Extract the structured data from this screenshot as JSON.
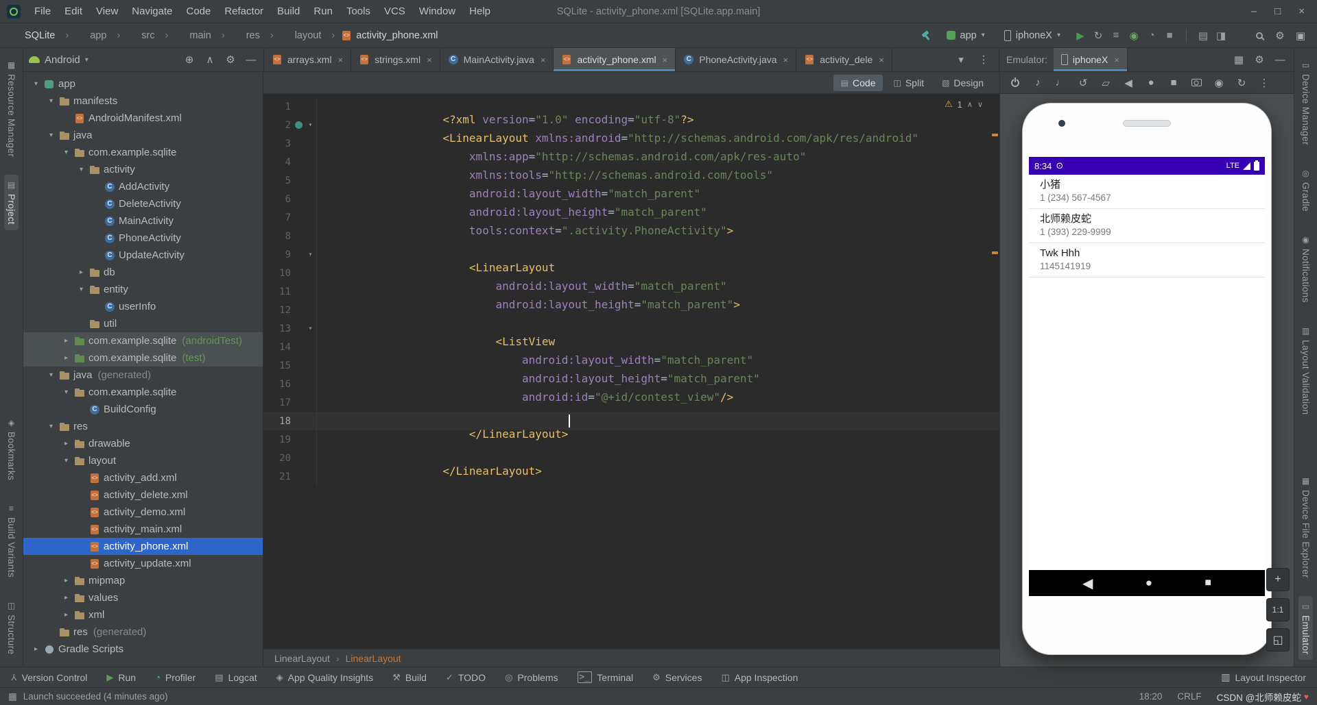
{
  "window": {
    "title": "SQLite - activity_phone.xml [SQLite.app.main]",
    "controls": [
      {
        "name": "minimize-button",
        "glyph": "–"
      },
      {
        "name": "maximize-button",
        "glyph": "□"
      },
      {
        "name": "close-button",
        "glyph": "×"
      }
    ]
  },
  "menu_bar": {
    "items": [
      "File",
      "Edit",
      "View",
      "Navigate",
      "Code",
      "Refactor",
      "Build",
      "Run",
      "Tools",
      "VCS",
      "Window",
      "Help"
    ]
  },
  "breadcrumb_bar": {
    "crumbs": [
      {
        "label": "SQLite",
        "bright": "true"
      },
      {
        "label": "app"
      },
      {
        "label": "src"
      },
      {
        "label": "main"
      },
      {
        "label": "res"
      },
      {
        "label": "layout"
      },
      {
        "label": "activity_phone.xml",
        "icon": "xml",
        "bright": "true"
      }
    ],
    "pre_icons": [
      {
        "name": "build-hammer-icon",
        "kind": "hammer",
        "glyph": ""
      }
    ],
    "run_config": {
      "label": "app"
    },
    "device": {
      "label": "iphoneX"
    },
    "run_icons": [
      {
        "name": "run-icon",
        "glyph": "▶",
        "color": "#499C54"
      },
      {
        "name": "apply-changes-icon",
        "glyph": "↻",
        "color": "#9da0a3"
      },
      {
        "name": "attach-debugger-icon",
        "glyph": "≡",
        "color": "#9da0a3"
      },
      {
        "name": "debug-icon",
        "glyph": "◉",
        "color": "#6ba65f"
      },
      {
        "name": "profile-icon",
        "glyph": "◔",
        "color": "#56A8A2"
      },
      {
        "name": "stop-icon",
        "glyph": "■",
        "color": "#8a8f94"
      }
    ],
    "extra_icons": [
      {
        "name": "device-manager-icon",
        "glyph": "▤",
        "color": "#9da0a3"
      },
      {
        "name": "pin-icon",
        "glyph": "◨",
        "color": "#9da0a3"
      }
    ],
    "global_icons": [
      {
        "name": "search-everywhere-icon",
        "kind": "search",
        "glyph": ""
      },
      {
        "name": "settings-gear-icon",
        "glyph": "⚙"
      },
      {
        "name": "window-layout-icon",
        "glyph": "▣"
      }
    ]
  },
  "left_stripe": {
    "items": [
      {
        "name": "stripe-resource-manager",
        "label": "Resource Manager",
        "glyph": "▦"
      },
      {
        "name": "stripe-project",
        "label": "Project",
        "glyph": "▤",
        "active": "true"
      },
      {
        "name": "stripe-bookmarks",
        "label": "Bookmarks",
        "glyph": "◈",
        "gap": "auto"
      },
      {
        "name": "stripe-build-variants",
        "label": "Build Variants",
        "glyph": "≡"
      },
      {
        "name": "stripe-structure",
        "label": "Structure",
        "glyph": "◫"
      }
    ]
  },
  "right_stripe": {
    "items": [
      {
        "name": "stripe-device-manager",
        "label": "Device Manager",
        "glyph": "▭"
      },
      {
        "name": "stripe-gradle",
        "label": "Gradle",
        "glyph": "◎"
      },
      {
        "name": "stripe-notifications",
        "label": "Notifications",
        "glyph": "◉"
      },
      {
        "name": "stripe-layout-validation",
        "label": "Layout Validation",
        "glyph": "▥"
      },
      {
        "name": "stripe-device-file-explorer",
        "label": "Device File Explorer",
        "glyph": "▦",
        "gap": "auto"
      },
      {
        "name": "stripe-emulator",
        "label": "Emulator",
        "glyph": "▭",
        "active": "true"
      }
    ]
  },
  "project_panel": {
    "view_selector": "Android",
    "header_icons": [
      {
        "name": "locate-file-icon",
        "glyph": "⊕"
      },
      {
        "name": "collapse-all-icon",
        "glyph": "∧"
      },
      {
        "name": "view-options-icon",
        "glyph": "⚙"
      },
      {
        "name": "hide-panel-icon",
        "glyph": "—"
      }
    ],
    "tree": [
      {
        "label": "app",
        "depth": 0,
        "icon": "app",
        "chev": "open"
      },
      {
        "label": "manifests",
        "depth": 1,
        "icon": "folder",
        "chev": "open"
      },
      {
        "label": "AndroidManifest.xml",
        "depth": 2,
        "icon": "xml",
        "chev": "none"
      },
      {
        "label": "java",
        "depth": 1,
        "icon": "folder",
        "chev": "open"
      },
      {
        "label": "com.example.sqlite",
        "depth": 2,
        "icon": "folder",
        "chev": "open"
      },
      {
        "label": "activity",
        "depth": 3,
        "icon": "folder",
        "chev": "open"
      },
      {
        "label": "AddActivity",
        "depth": 4,
        "icon": "class",
        "chev": "none"
      },
      {
        "label": "DeleteActivity",
        "depth": 4,
        "icon": "class",
        "chev": "none"
      },
      {
        "label": "MainActivity",
        "depth": 4,
        "icon": "class",
        "chev": "none"
      },
      {
        "label": "PhoneActivity",
        "depth": 4,
        "icon": "class",
        "chev": "none"
      },
      {
        "label": "UpdateActivity",
        "depth": 4,
        "icon": "class",
        "chev": "none"
      },
      {
        "label": "db",
        "depth": 3,
        "icon": "folder",
        "chev": "closed"
      },
      {
        "label": "entity",
        "depth": 3,
        "icon": "folder",
        "chev": "open"
      },
      {
        "label": "userInfo",
        "depth": 4,
        "icon": "class",
        "chev": "none"
      },
      {
        "label": "util",
        "depth": 3,
        "icon": "folder",
        "chev": "none"
      },
      {
        "label": "com.example.sqlite",
        "suffix": "(androidTest)",
        "sfx": "green",
        "depth": 2,
        "icon": "folder-green",
        "chev": "closed",
        "sel": "gray"
      },
      {
        "label": "com.example.sqlite",
        "suffix": "(test)",
        "sfx": "green",
        "depth": 2,
        "icon": "folder-green",
        "chev": "closed",
        "sel": "gray"
      },
      {
        "label": "java",
        "suffix": "(generated)",
        "sfx": "gray",
        "depth": 1,
        "icon": "folder",
        "chev": "open"
      },
      {
        "label": "com.example.sqlite",
        "depth": 2,
        "icon": "folder",
        "chev": "open"
      },
      {
        "label": "BuildConfig",
        "depth": 3,
        "icon": "class",
        "chev": "none"
      },
      {
        "label": "res",
        "depth": 1,
        "icon": "folder",
        "chev": "open"
      },
      {
        "label": "drawable",
        "depth": 2,
        "icon": "folder",
        "chev": "closed"
      },
      {
        "label": "layout",
        "depth": 2,
        "icon": "folder",
        "chev": "open"
      },
      {
        "label": "activity_add.xml",
        "depth": 3,
        "icon": "xml",
        "chev": "none"
      },
      {
        "label": "activity_delete.xml",
        "depth": 3,
        "icon": "xml",
        "chev": "none"
      },
      {
        "label": "activity_demo.xml",
        "depth": 3,
        "icon": "xml",
        "chev": "none"
      },
      {
        "label": "activity_main.xml",
        "depth": 3,
        "icon": "xml",
        "chev": "none"
      },
      {
        "label": "activity_phone.xml",
        "depth": 3,
        "icon": "xml",
        "chev": "none",
        "sel": "blue"
      },
      {
        "label": "activity_update.xml",
        "depth": 3,
        "icon": "xml",
        "chev": "none"
      },
      {
        "label": "mipmap",
        "depth": 2,
        "icon": "folder",
        "chev": "closed"
      },
      {
        "label": "values",
        "depth": 2,
        "icon": "folder",
        "chev": "closed"
      },
      {
        "label": "xml",
        "depth": 2,
        "icon": "folder",
        "chev": "closed"
      },
      {
        "label": "res",
        "suffix": "(generated)",
        "sfx": "gray",
        "depth": 1,
        "icon": "folder",
        "chev": "none"
      },
      {
        "label": "Gradle Scripts",
        "depth": 0,
        "icon": "gradle",
        "chev": "closed"
      }
    ]
  },
  "editor": {
    "tabs": [
      {
        "label": "arrays.xml",
        "icon": "xml"
      },
      {
        "label": "strings.xml",
        "icon": "xml"
      },
      {
        "label": "MainActivity.java",
        "icon": "class"
      },
      {
        "label": "activity_phone.xml",
        "icon": "xml",
        "active": "true"
      },
      {
        "label": "PhoneActivity.java",
        "icon": "class"
      },
      {
        "label": "activity_dele",
        "icon": "xml"
      }
    ],
    "tab_close": "×",
    "trailing_icons": [
      {
        "name": "hidden-tabs-icon",
        "glyph": "▾"
      },
      {
        "name": "tab-options-icon",
        "glyph": "⋮"
      }
    ],
    "view_modes": [
      {
        "label": "Code",
        "glyph": "▤",
        "active": "true"
      },
      {
        "label": "Split",
        "glyph": "◫"
      },
      {
        "label": "Design",
        "glyph": "▧"
      }
    ],
    "inspection": {
      "warning_glyph": "⚠",
      "count": "1",
      "up": "∧",
      "down": "∨"
    },
    "breadcrumbs": [
      {
        "label": "LinearLayout"
      },
      {
        "label": "LinearLayout",
        "current": "true"
      }
    ],
    "code_lines": [
      {
        "n": "1",
        "seg": [
          {
            "t": "tag",
            "x": "<?xml "
          },
          {
            "t": "attr",
            "x": "version"
          },
          {
            "t": "p",
            "x": "="
          },
          {
            "t": "str",
            "x": "\"1.0\""
          },
          {
            "t": "p",
            "x": " "
          },
          {
            "t": "attr",
            "x": "encoding"
          },
          {
            "t": "p",
            "x": "="
          },
          {
            "t": "str",
            "x": "\"utf-8\""
          },
          {
            "t": "tag",
            "x": "?>"
          }
        ]
      },
      {
        "n": "2",
        "fold": "start",
        "mark": "circle",
        "seg": [
          {
            "t": "tag",
            "x": "<LinearLayout "
          },
          {
            "t": "attr",
            "x": "xmlns:android"
          },
          {
            "t": "p",
            "x": "="
          },
          {
            "t": "str",
            "x": "\"http://schemas.android.com/apk/res/android\""
          }
        ]
      },
      {
        "n": "3",
        "seg": [
          {
            "t": "p",
            "x": "    "
          },
          {
            "t": "attr",
            "x": "xmlns:app"
          },
          {
            "t": "p",
            "x": "="
          },
          {
            "t": "str",
            "x": "\"http://schemas.android.com/apk/res-auto\""
          }
        ]
      },
      {
        "n": "4",
        "seg": [
          {
            "t": "p",
            "x": "    "
          },
          {
            "t": "attr",
            "x": "xmlns:tools"
          },
          {
            "t": "p",
            "x": "="
          },
          {
            "t": "str",
            "x": "\"http://schemas.android.com/tools\""
          }
        ]
      },
      {
        "n": "5",
        "seg": [
          {
            "t": "p",
            "x": "    "
          },
          {
            "t": "attr",
            "x": "android:layout_width"
          },
          {
            "t": "p",
            "x": "="
          },
          {
            "t": "str",
            "x": "\"match_parent\""
          }
        ]
      },
      {
        "n": "6",
        "seg": [
          {
            "t": "p",
            "x": "    "
          },
          {
            "t": "attr",
            "x": "android:layout_height"
          },
          {
            "t": "p",
            "x": "="
          },
          {
            "t": "str",
            "x": "\"match_parent\""
          }
        ]
      },
      {
        "n": "7",
        "seg": [
          {
            "t": "p",
            "x": "    "
          },
          {
            "t": "attr",
            "x": "tools:context"
          },
          {
            "t": "p",
            "x": "="
          },
          {
            "t": "str",
            "x": "\".activity.PhoneActivity\""
          },
          {
            "t": "tag",
            "x": ">"
          }
        ]
      },
      {
        "n": "8",
        "seg": []
      },
      {
        "n": "9",
        "fold": "start",
        "seg": [
          {
            "t": "p",
            "x": "    "
          },
          {
            "t": "tag",
            "x": "<LinearLayout"
          }
        ]
      },
      {
        "n": "10",
        "seg": [
          {
            "t": "p",
            "x": "        "
          },
          {
            "t": "attr",
            "x": "android:layout_width"
          },
          {
            "t": "p",
            "x": "="
          },
          {
            "t": "str",
            "x": "\"match_parent\""
          }
        ]
      },
      {
        "n": "11",
        "seg": [
          {
            "t": "p",
            "x": "        "
          },
          {
            "t": "attr",
            "x": "android:layout_height"
          },
          {
            "t": "p",
            "x": "="
          },
          {
            "t": "str",
            "x": "\"match_parent\""
          },
          {
            "t": "tag",
            "x": ">"
          }
        ]
      },
      {
        "n": "12",
        "seg": []
      },
      {
        "n": "13",
        "fold": "start",
        "seg": [
          {
            "t": "p",
            "x": "        "
          },
          {
            "t": "tag",
            "x": "<ListView"
          }
        ]
      },
      {
        "n": "14",
        "seg": [
          {
            "t": "p",
            "x": "            "
          },
          {
            "t": "attr",
            "x": "android:layout_width"
          },
          {
            "t": "p",
            "x": "="
          },
          {
            "t": "str",
            "x": "\"match_parent\""
          }
        ]
      },
      {
        "n": "15",
        "seg": [
          {
            "t": "p",
            "x": "            "
          },
          {
            "t": "attr",
            "x": "android:layout_height"
          },
          {
            "t": "p",
            "x": "="
          },
          {
            "t": "str",
            "x": "\"match_parent\""
          }
        ]
      },
      {
        "n": "16",
        "seg": [
          {
            "t": "p",
            "x": "            "
          },
          {
            "t": "attr",
            "x": "android:id"
          },
          {
            "t": "p",
            "x": "="
          },
          {
            "t": "str",
            "x": "\"@+id/contest_view\""
          },
          {
            "t": "tag",
            "x": "/>"
          }
        ]
      },
      {
        "n": "17",
        "seg": []
      },
      {
        "n": "18",
        "caret": "true",
        "seg": [
          {
            "t": "p",
            "x": "    "
          },
          {
            "t": "tag",
            "x": "</LinearLayout>"
          }
        ]
      },
      {
        "n": "19",
        "seg": []
      },
      {
        "n": "20",
        "seg": [
          {
            "t": "tag",
            "x": "</LinearLayout>"
          }
        ]
      },
      {
        "n": "21",
        "seg": []
      }
    ]
  },
  "emulator": {
    "panel_label": "Emulator:",
    "tab": {
      "label": "iphoneX",
      "close": "×"
    },
    "header_icons": [
      {
        "name": "grid-icon",
        "glyph": "▦"
      },
      {
        "name": "emulator-settings-icon",
        "glyph": "⚙"
      },
      {
        "name": "hide-emulator-icon",
        "glyph": "—"
      }
    ],
    "toolbar": [
      {
        "name": "power-icon",
        "kind": "power",
        "glyph": ""
      },
      {
        "name": "volume-up-icon",
        "glyph": "♪"
      },
      {
        "name": "volume-down-icon",
        "glyph": "♩"
      },
      {
        "name": "rotate-left-icon",
        "glyph": "↺"
      },
      {
        "name": "fold-icon",
        "glyph": "▱"
      },
      {
        "name": "back-icon",
        "glyph": "◀"
      },
      {
        "name": "home-icon",
        "glyph": "●"
      },
      {
        "name": "overview-icon",
        "glyph": "■"
      },
      {
        "name": "screenshot-camera-icon",
        "kind": "camera",
        "glyph": ""
      },
      {
        "name": "screen-record-icon",
        "glyph": "◉"
      },
      {
        "name": "snapshot-icon",
        "glyph": "↻"
      },
      {
        "name": "more-icon",
        "glyph": "⋮"
      }
    ],
    "phone": {
      "status_time": "8:34",
      "status_left_icon": "⊙",
      "status_net": "LTE",
      "contacts": [
        {
          "name": "小猪",
          "number": "1 (234) 567-4567"
        },
        {
          "name": "北师赖皮蛇",
          "number": "1 (393) 229-9999"
        },
        {
          "name": "Twk Hhh",
          "number": "1145141919"
        }
      ],
      "nav": [
        {
          "name": "back-icon",
          "glyph": "◀"
        },
        {
          "name": "home-icon",
          "glyph": "●"
        },
        {
          "name": "overview-icon",
          "glyph": "■"
        }
      ]
    },
    "zoom": [
      {
        "name": "zoom-in-button",
        "glyph": "+"
      },
      {
        "name": "zoom-reset-button",
        "glyph": "1:1"
      },
      {
        "name": "zoom-fit-button",
        "glyph": "◱"
      }
    ]
  },
  "tool_bar": {
    "items": [
      {
        "label": "Version Control",
        "glyph": "Y",
        "rot": "180"
      },
      {
        "label": "Run",
        "glyph": "▶",
        "color": "#5F9E5A"
      },
      {
        "label": "Profiler",
        "glyph": "◔",
        "color": "#56A8A2"
      },
      {
        "label": "Logcat",
        "glyph": "▤"
      },
      {
        "label": "App Quality Insights",
        "glyph": "◈"
      },
      {
        "label": "Build",
        "glyph": "⚒"
      },
      {
        "label": "TODO",
        "glyph": "✓"
      },
      {
        "label": "Problems",
        "glyph": "◎"
      },
      {
        "label": "Terminal",
        "glyph": ">_",
        "kind": "term"
      },
      {
        "label": "Services",
        "glyph": "⚙"
      },
      {
        "label": "App Inspection",
        "glyph": "◫"
      }
    ],
    "right": {
      "label": "Layout Inspector",
      "glyph": "▥"
    }
  },
  "status_bar": {
    "panel_icon": "▦",
    "message": "Launch succeeded (4 minutes ago)",
    "time": "18:20",
    "line_ending": "CRLF",
    "watermark_text": "CSDN @北师赖皮蛇",
    "watermark_heart": "♥"
  }
}
